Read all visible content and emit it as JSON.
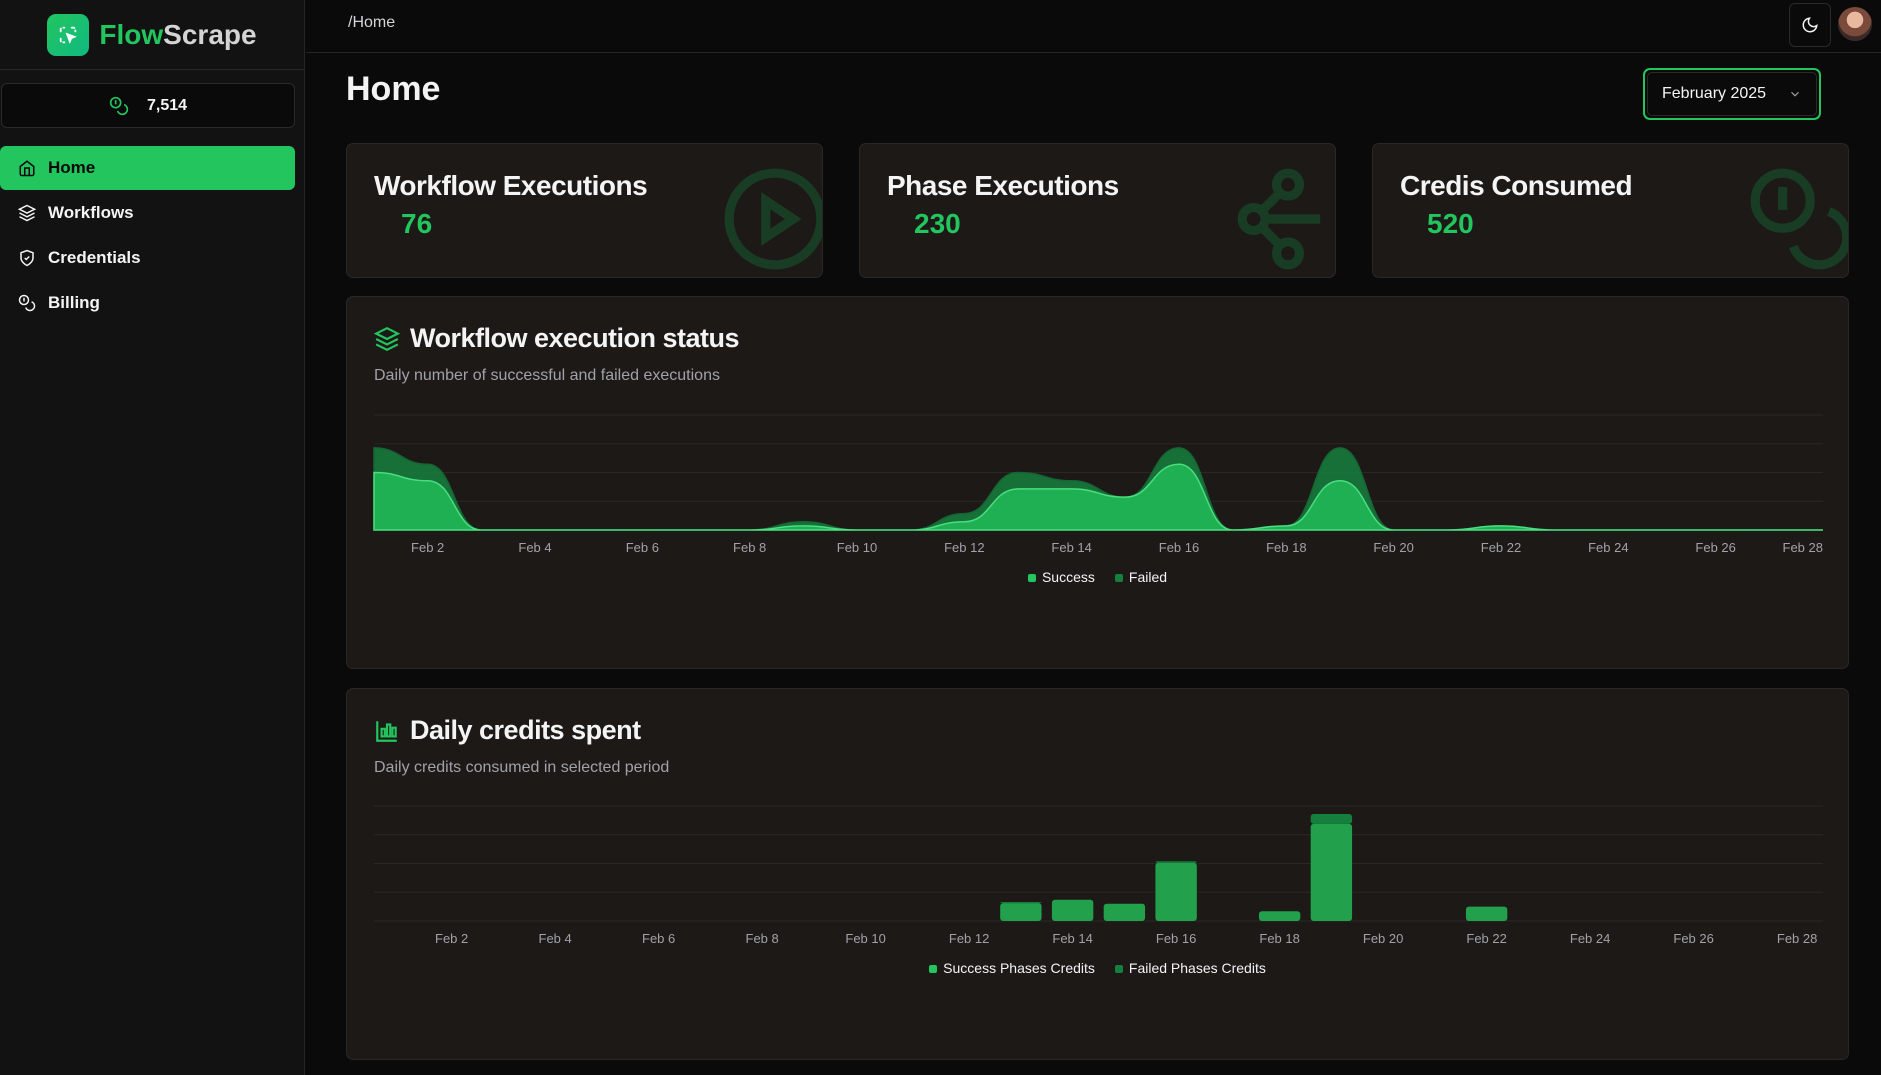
{
  "app": {
    "name_part1": "Flow",
    "name_part2": "Scrape"
  },
  "credits": {
    "balance": "7,514"
  },
  "sidebar": {
    "items": [
      {
        "label": "Home",
        "icon": "home-icon",
        "active": true
      },
      {
        "label": "Workflows",
        "icon": "layers-icon",
        "active": false
      },
      {
        "label": "Credentials",
        "icon": "shield-icon",
        "active": false
      },
      {
        "label": "Billing",
        "icon": "coins-icon",
        "active": false
      }
    ]
  },
  "header": {
    "breadcrumb": "/Home"
  },
  "page": {
    "title": "Home",
    "period": "February 2025"
  },
  "stats": [
    {
      "title": "Workflow Executions",
      "value": "76",
      "icon": "circle-play-icon"
    },
    {
      "title": "Phase Executions",
      "value": "230",
      "icon": "waypoints-icon"
    },
    {
      "title": "Credis Consumed",
      "value": "520",
      "icon": "coins-icon"
    }
  ],
  "colors": {
    "accent": "#22c55e",
    "success": "#22c55e",
    "failed": "#15803d"
  },
  "chart_data": [
    {
      "type": "area",
      "title": "Workflow execution status",
      "subtitle": "Daily number of successful and failed executions",
      "x": [
        "Feb 1",
        "Feb 2",
        "Feb 3",
        "Feb 4",
        "Feb 5",
        "Feb 6",
        "Feb 7",
        "Feb 8",
        "Feb 9",
        "Feb 10",
        "Feb 11",
        "Feb 12",
        "Feb 13",
        "Feb 14",
        "Feb 15",
        "Feb 16",
        "Feb 17",
        "Feb 18",
        "Feb 19",
        "Feb 20",
        "Feb 21",
        "Feb 22",
        "Feb 23",
        "Feb 24",
        "Feb 25",
        "Feb 26",
        "Feb 27",
        "Feb 28"
      ],
      "tick_labels": [
        "Feb 2",
        "Feb 4",
        "Feb 6",
        "Feb 8",
        "Feb 10",
        "Feb 12",
        "Feb 14",
        "Feb 16",
        "Feb 18",
        "Feb 20",
        "Feb 22",
        "Feb 24",
        "Feb 26",
        "Feb 28"
      ],
      "stacked": true,
      "series": [
        {
          "name": "Success",
          "values": [
            7,
            6,
            0,
            0,
            0,
            0,
            0,
            0,
            0.5,
            0,
            0,
            1,
            5,
            5,
            4,
            8,
            0,
            0.5,
            6,
            0,
            0,
            0.5,
            0,
            0,
            0,
            0,
            0,
            0
          ]
        },
        {
          "name": "Failed",
          "values": [
            3,
            2,
            0,
            0,
            0,
            0,
            0,
            0,
            0.5,
            0,
            0,
            1,
            2,
            1,
            0,
            2,
            0,
            0,
            4,
            0,
            0,
            0,
            0,
            0,
            0,
            0,
            0,
            0
          ]
        }
      ],
      "ylim": [
        0,
        14
      ],
      "grid": true,
      "legend": "bottom-center"
    },
    {
      "type": "bar",
      "title": "Daily credits spent",
      "subtitle": "Daily credits consumed in selected period",
      "x": [
        "Feb 1",
        "Feb 2",
        "Feb 3",
        "Feb 4",
        "Feb 5",
        "Feb 6",
        "Feb 7",
        "Feb 8",
        "Feb 9",
        "Feb 10",
        "Feb 11",
        "Feb 12",
        "Feb 13",
        "Feb 14",
        "Feb 15",
        "Feb 16",
        "Feb 17",
        "Feb 18",
        "Feb 19",
        "Feb 20",
        "Feb 21",
        "Feb 22",
        "Feb 23",
        "Feb 24",
        "Feb 25",
        "Feb 26",
        "Feb 27",
        "Feb 28"
      ],
      "tick_labels": [
        "Feb 2",
        "Feb 4",
        "Feb 6",
        "Feb 8",
        "Feb 10",
        "Feb 12",
        "Feb 14",
        "Feb 16",
        "Feb 18",
        "Feb 20",
        "Feb 22",
        "Feb 24",
        "Feb 26",
        "Feb 28"
      ],
      "stacked": true,
      "series": [
        {
          "name": "Success Phases Credits",
          "values": [
            0,
            0,
            0,
            0,
            0,
            0,
            0,
            0,
            0,
            0,
            0,
            0,
            31,
            37,
            30,
            101,
            0,
            17,
            169,
            0,
            0,
            25,
            0,
            0,
            0,
            0,
            0,
            0
          ]
        },
        {
          "name": "Failed Phases Credits",
          "values": [
            0,
            0,
            0,
            0,
            0,
            0,
            0,
            0,
            0,
            0,
            0,
            0,
            2,
            0,
            0,
            3,
            0,
            0,
            17,
            0,
            0,
            0,
            0,
            0,
            0,
            0,
            0,
            0
          ]
        }
      ],
      "ylim": [
        0,
        200
      ],
      "grid": true,
      "legend": "bottom-center"
    }
  ]
}
